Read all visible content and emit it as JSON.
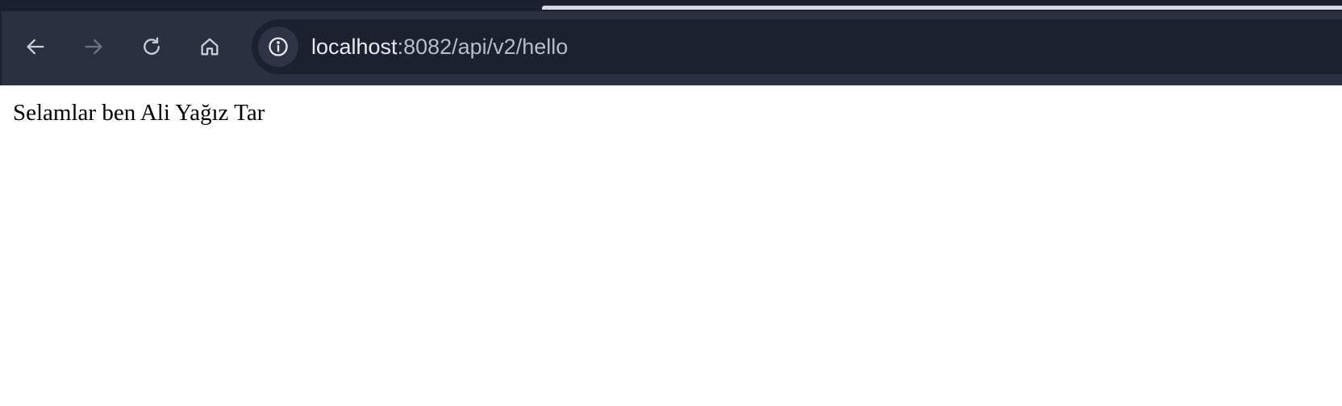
{
  "browser": {
    "toolbar": {
      "back_icon": "arrow-left",
      "forward_icon": "arrow-right",
      "reload_icon": "reload",
      "home_icon": "home",
      "forward_disabled": true
    },
    "address_bar": {
      "site_info_icon": "info",
      "url_host": "localhost",
      "url_rest": ":8082/api/v2/hello"
    }
  },
  "page": {
    "body_text": "Selamlar ben Ali Yağız Tar"
  },
  "colors": {
    "chrome_bg": "#2b3040",
    "omnibox_bg": "#1c2130",
    "icon_active": "#c9cdd6",
    "icon_disabled": "#6d7385",
    "page_bg": "#ffffff"
  }
}
